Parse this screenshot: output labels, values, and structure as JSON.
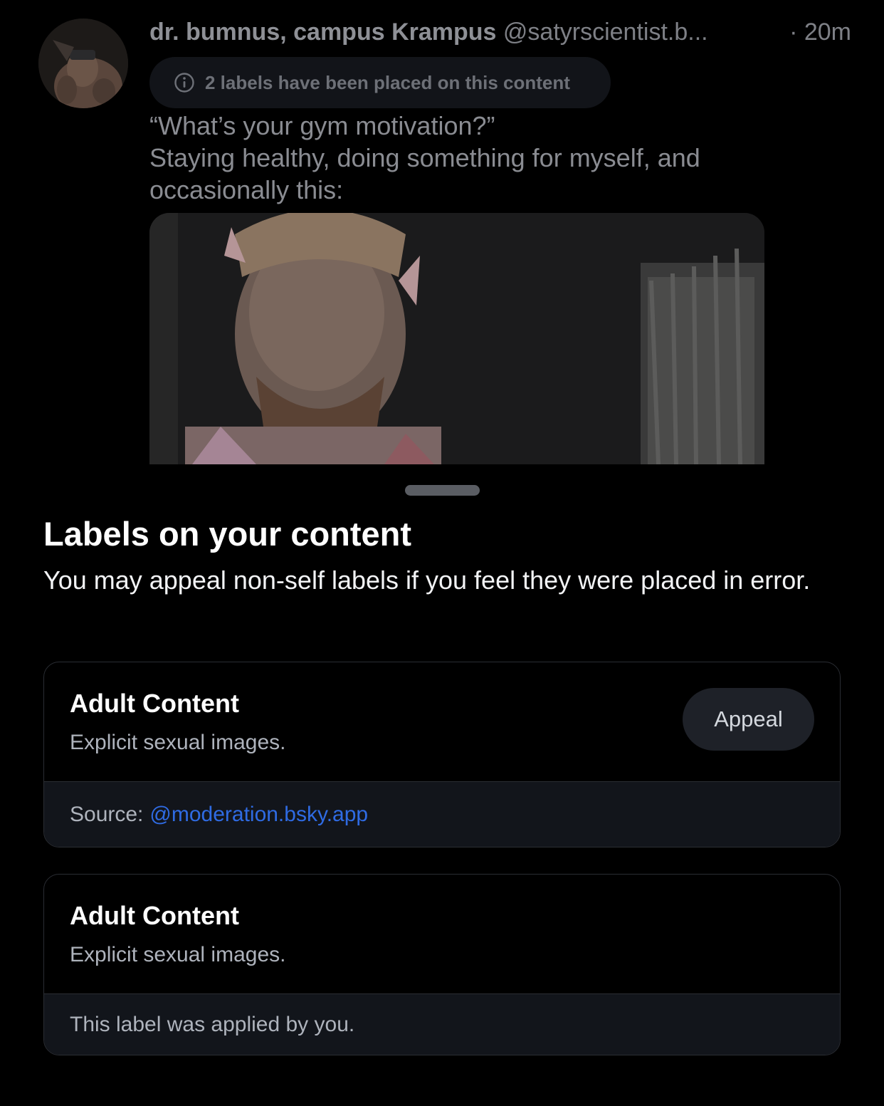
{
  "post": {
    "author_name": "dr. bumnus, campus Krampus",
    "author_handle": "@satyrscientist.b...",
    "time": "· 20m",
    "labels_notice": "2 labels have been placed on this content",
    "text_lines": [
      "“What’s your gym motivation?”",
      "Staying healthy, doing something for myself, and",
      "occasionally this:"
    ],
    "icons": {
      "avatar": "avatar-photo",
      "labels_notice": "info-circle-icon"
    }
  },
  "sheet": {
    "title": "Labels on your content",
    "subtitle": "You may appeal non-self labels if you feel they were placed in error.",
    "labels": [
      {
        "title": "Adult Content",
        "description": "Explicit sexual images.",
        "action_label": "Appeal",
        "source_prefix": "Source:",
        "source_link": "@moderation.bsky.app"
      },
      {
        "title": "Adult Content",
        "description": "Explicit sexual images.",
        "footer_text": "This label was applied by you."
      }
    ]
  },
  "colors": {
    "background": "#000000",
    "card_border": "#2a2d33",
    "card_footer_bg": "#12151b",
    "link": "#2f6be3",
    "button_bg": "#1e2128",
    "muted_text": "#aeb3bc"
  }
}
